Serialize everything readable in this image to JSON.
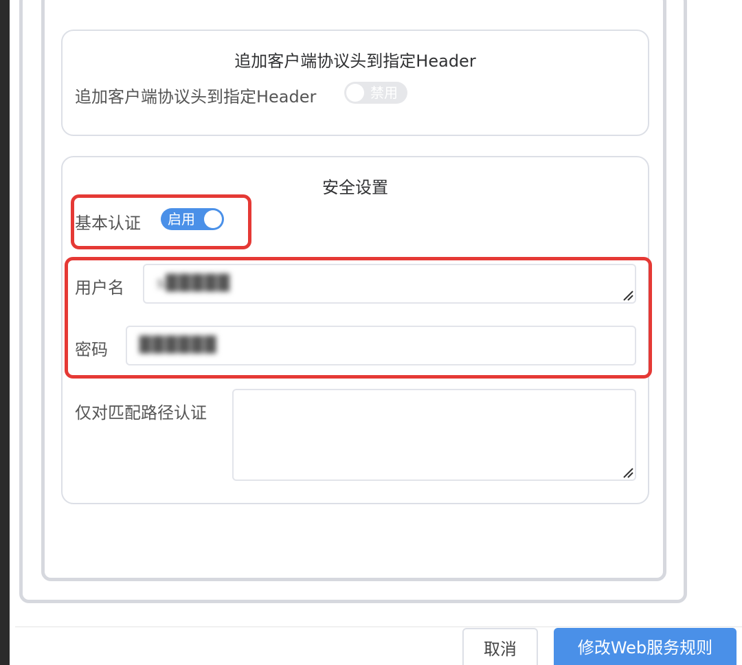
{
  "header_card": {
    "title": "追加客户端协议头到指定Header",
    "row_label": "追加客户端协议头到指定Header",
    "toggle_text": "禁用",
    "toggle_on": false
  },
  "security_card": {
    "title": "安全设置",
    "basic_auth_label": "基本认证",
    "basic_auth_toggle_text": "启用",
    "basic_auth_on": true,
    "username_label": "用户名",
    "username_value": "s█████",
    "password_label": "密码",
    "password_value": "██████",
    "path_auth_label": "仅对匹配路径认证",
    "path_auth_value": ""
  },
  "footer": {
    "cancel_label": "取消",
    "submit_label": "修改Web服务规则"
  },
  "colors": {
    "accent": "#4a90e8",
    "highlight": "#e53935"
  }
}
